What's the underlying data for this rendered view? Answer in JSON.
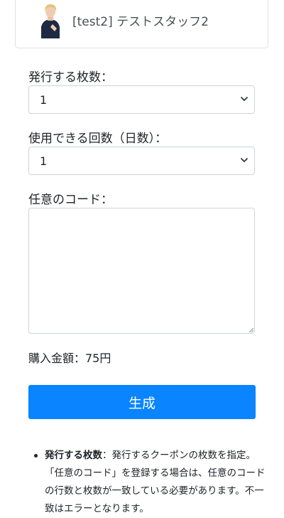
{
  "staff": {
    "name": "[test2] テストスタッフ2"
  },
  "issue_count": {
    "label": "発行する枚数：",
    "selected": "1"
  },
  "usage_count": {
    "label": "使用できる回数（日数）：",
    "selected": "1"
  },
  "custom_code": {
    "label": "任意のコード：",
    "value": ""
  },
  "price": {
    "text": "購入金額：75円"
  },
  "generate_button": {
    "label": "生成"
  },
  "notes": {
    "item1_title": "発行する枚数",
    "item1_text": "：発行するクーポンの枚数を指定。「任意のコード」を登録する場合は、任意のコードの行数と枚数が一致している必要があります。不一致はエラーとなります。"
  }
}
